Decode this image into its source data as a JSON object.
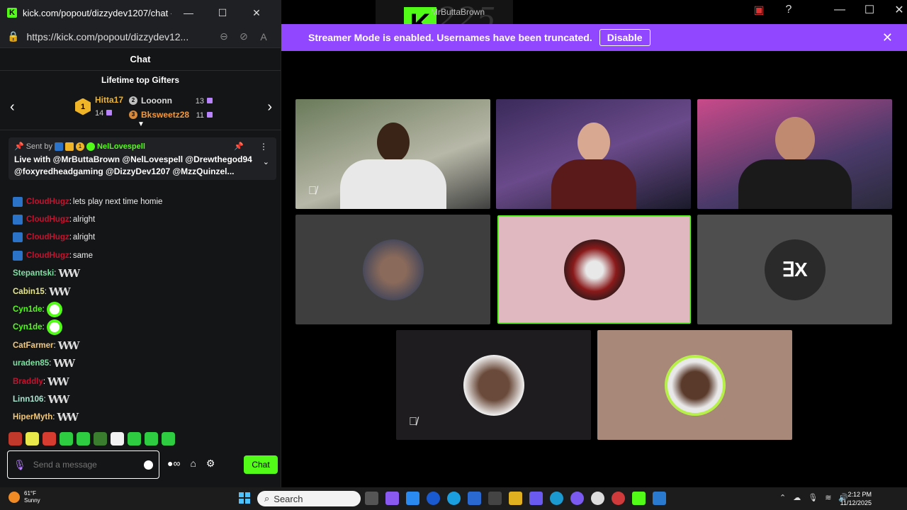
{
  "window": {
    "title": "kick.com/popout/dizzydev1207/chat -...",
    "url": "https://kick.com/popout/dizzydev12..."
  },
  "chat": {
    "header": "Chat",
    "gifters": {
      "title": "Lifetime top Gifters",
      "first": {
        "rank": "1",
        "name": "Hitta17",
        "count": "14"
      },
      "second": {
        "rank": "2",
        "name": "Looonn",
        "count": "13"
      },
      "third": {
        "rank": "3",
        "name": "Bksweetz28",
        "count": "11"
      }
    },
    "pinned": {
      "sent_by": "Sent by",
      "badge_count": "1",
      "sender": "NelLovespell",
      "message": "Live with @MrButtaBrown @NelLovespell @Drewthegod94 @foxyredheadgaming @DizzyDev1207 @MzzQuinzel..."
    },
    "messages": [
      {
        "user": "CloudHugz",
        "color": "#c4122f",
        "text": "lets play next time homie",
        "badge": true
      },
      {
        "user": "CloudHugz",
        "color": "#c4122f",
        "text": "alright",
        "badge": true
      },
      {
        "user": "CloudHugz",
        "color": "#c4122f",
        "text": "alright",
        "badge": true
      },
      {
        "user": "CloudHugz",
        "color": "#c4122f",
        "text": "same",
        "badge": true
      },
      {
        "user": "Stepantski",
        "color": "#7ee0a3",
        "text": "",
        "emote": "w"
      },
      {
        "user": "Cabin15",
        "color": "#e8e88a",
        "text": "",
        "emote": "w"
      },
      {
        "user": "Cyn1de",
        "color": "#53fc18",
        "text": "",
        "emote": "face"
      },
      {
        "user": "Cyn1de",
        "color": "#53fc18",
        "text": "",
        "emote": "face"
      },
      {
        "user": "CatFarmer",
        "color": "#f3c87a",
        "text": "",
        "emote": "w"
      },
      {
        "user": "uraden85",
        "color": "#7ee0a3",
        "text": "",
        "emote": "w"
      },
      {
        "user": "Braddly",
        "color": "#c4122f",
        "text": "",
        "emote": "w"
      },
      {
        "user": "Linn106",
        "color": "#a8e6cf",
        "text": "",
        "emote": "w"
      },
      {
        "user": "HiperMyth",
        "color": "#f3c87a",
        "text": "",
        "emote": "w"
      }
    ],
    "input_placeholder": "Send a message",
    "send_label": "Chat"
  },
  "banner": {
    "text": "Streamer Mode is enabled. Usernames have been truncated.",
    "button": "Disable"
  },
  "watermark": {
    "number": "225",
    "name": "MrButtaBrown"
  },
  "taskbar": {
    "temp": "61°F",
    "condition": "Sunny",
    "search": "Search",
    "time": "2:12 PM",
    "date": "11/12/2025"
  },
  "colors": {
    "kick_green": "#53fc18",
    "banner_purple": "#9147ff",
    "highlight_border": "#53fc18"
  }
}
